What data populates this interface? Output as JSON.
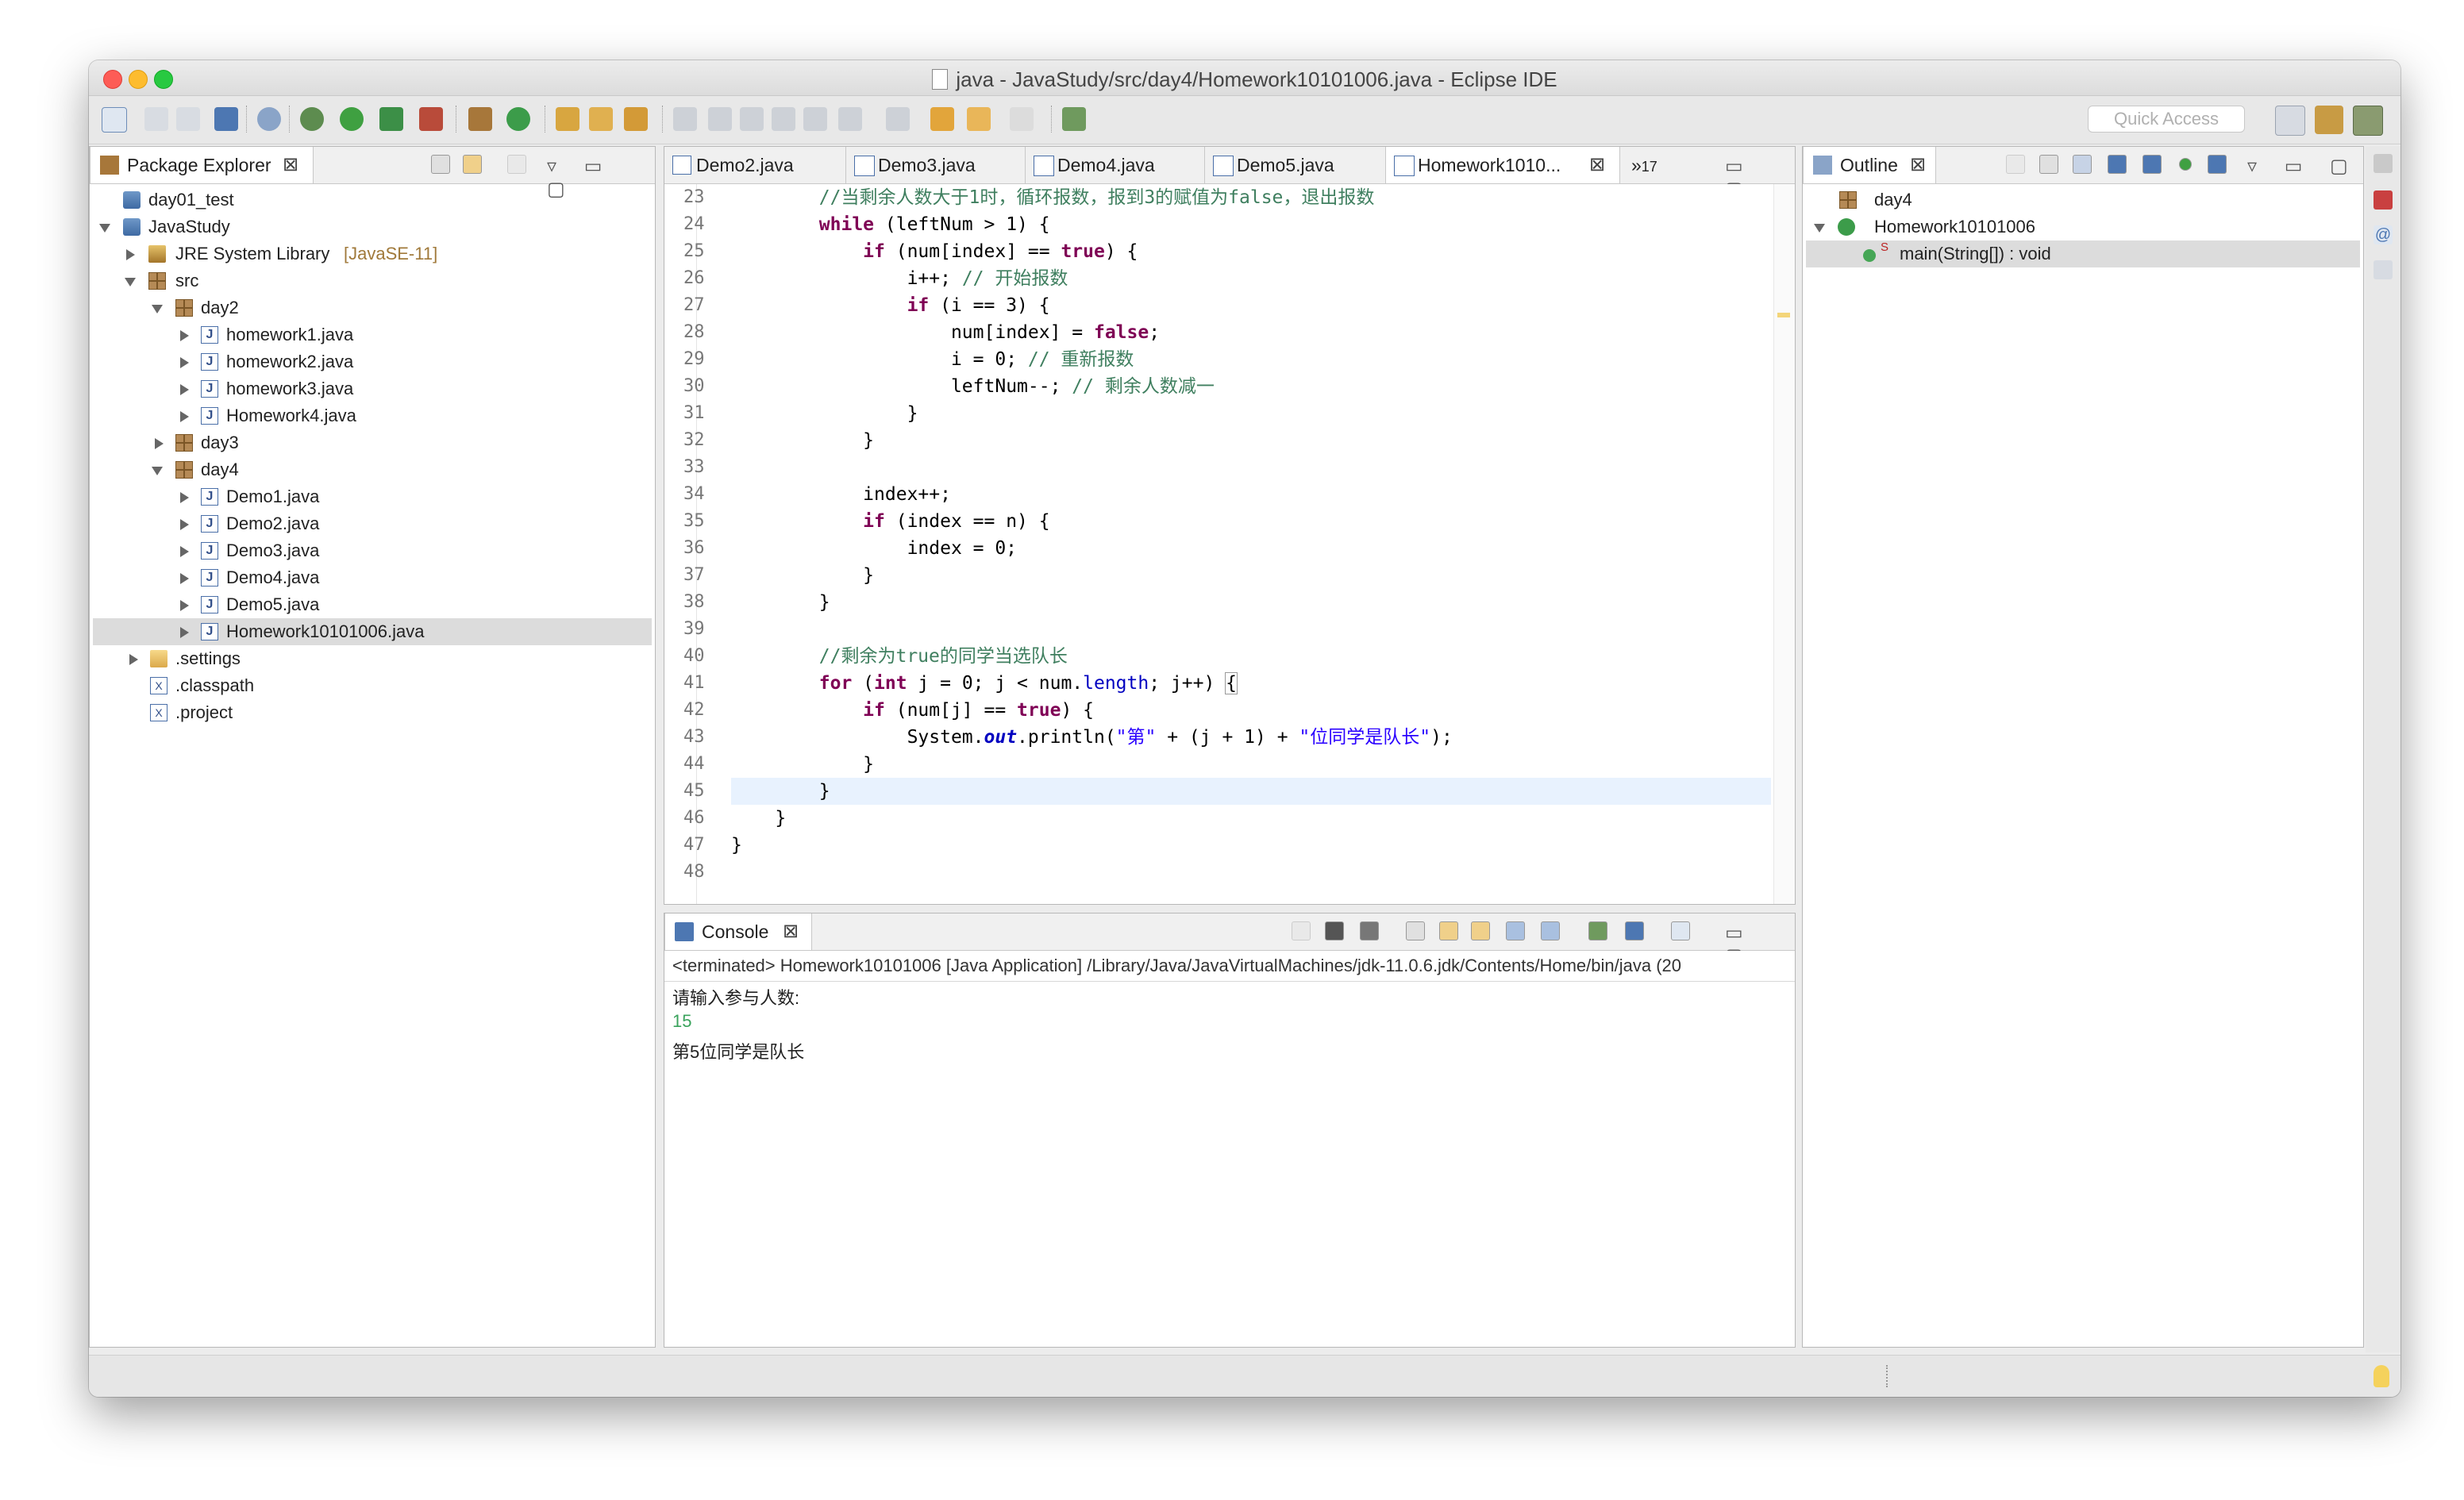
{
  "window": {
    "title": "java - JavaStudy/src/day4/Homework10101006.java - Eclipse IDE"
  },
  "toolbar": {
    "quick_access_placeholder": "Quick Access"
  },
  "package_explorer": {
    "tab_label": "Package Explorer",
    "items": [
      {
        "label": "day01_test"
      },
      {
        "label": "JavaStudy"
      },
      {
        "label": "JRE System Library",
        "suffix": "[JavaSE-11]"
      },
      {
        "label": "src"
      },
      {
        "label": "day2"
      },
      {
        "label": "homework1.java"
      },
      {
        "label": "homework2.java"
      },
      {
        "label": "homework3.java"
      },
      {
        "label": "Homework4.java"
      },
      {
        "label": "day3"
      },
      {
        "label": "day4"
      },
      {
        "label": "Demo1.java"
      },
      {
        "label": "Demo2.java"
      },
      {
        "label": "Demo3.java"
      },
      {
        "label": "Demo4.java"
      },
      {
        "label": "Demo5.java"
      },
      {
        "label": "Homework10101006.java"
      },
      {
        "label": ".settings"
      },
      {
        "label": ".classpath"
      },
      {
        "label": ".project"
      }
    ]
  },
  "editor": {
    "tabs": [
      {
        "label": "Demo2.java"
      },
      {
        "label": "Demo3.java"
      },
      {
        "label": "Demo4.java"
      },
      {
        "label": "Demo5.java"
      },
      {
        "label": "Homework1010..."
      }
    ],
    "overflow_count": "17",
    "line_numbers": [
      "23",
      "24",
      "25",
      "26",
      "27",
      "28",
      "29",
      "30",
      "31",
      "32",
      "33",
      "34",
      "35",
      "36",
      "37",
      "38",
      "39",
      "40",
      "41",
      "42",
      "43",
      "44",
      "45",
      "46",
      "47",
      "48"
    ],
    "code": {
      "l23": "//当剩余人数大于1时，循环报数，报到3的赋值为false，退出报数",
      "l24_kw": "while",
      "l24_rest": " (leftNum > 1) {",
      "l25_kw": "if",
      "l25_rest": " (num[index] == ",
      "l25_true": "true",
      "l25_end": ") {",
      "l26_code": "i++; ",
      "l26_cm": "// 开始报数",
      "l27_kw": "if",
      "l27_rest": " (i == 3) {",
      "l28_code": "num[index] = ",
      "l28_false": "false",
      "l28_end": ";",
      "l29_code": "i = 0; ",
      "l29_cm": "// 重新报数",
      "l30_code": "leftNum--; ",
      "l30_cm": "// 剩余人数减一",
      "l31": "}",
      "l32": "}",
      "l34": "index++;",
      "l35_kw": "if",
      "l35_rest": " (index == n) {",
      "l36": "index = 0;",
      "l37": "}",
      "l38": "}",
      "l40": "//剩余为true的同学当选队长",
      "l41_kw": "for",
      "l41_a": " (",
      "l41_int": "int",
      "l41_b": " j = 0; j < num.",
      "l41_len": "length",
      "l41_c": "; j++) ",
      "l41_brace": "{",
      "l42_kw": "if",
      "l42_rest": " (num[j] == ",
      "l42_true": "true",
      "l42_end": ") {",
      "l43_a": "System.",
      "l43_out": "out",
      "l43_b": ".println(",
      "l43_s1": "\"第\"",
      "l43_c": " + (j + 1) + ",
      "l43_s2": "\"位同学是队长\"",
      "l43_d": ");",
      "l44": "}",
      "l45": "}",
      "l46": "}",
      "l47": "}"
    }
  },
  "outline": {
    "tab_label": "Outline",
    "items": [
      {
        "label": "day4"
      },
      {
        "label": "Homework10101006"
      },
      {
        "label": "main(String[]) : void",
        "modifier": "S"
      }
    ]
  },
  "console": {
    "tab_label": "Console",
    "status": "<terminated> Homework10101006 [Java Application] /Library/Java/JavaVirtualMachines/jdk-11.0.6.jdk/Contents/Home/bin/java (20",
    "lines": [
      {
        "text": "请输入参与人数:"
      },
      {
        "text": "15",
        "input": true
      },
      {
        "text": "第5位同学是队长"
      }
    ]
  }
}
